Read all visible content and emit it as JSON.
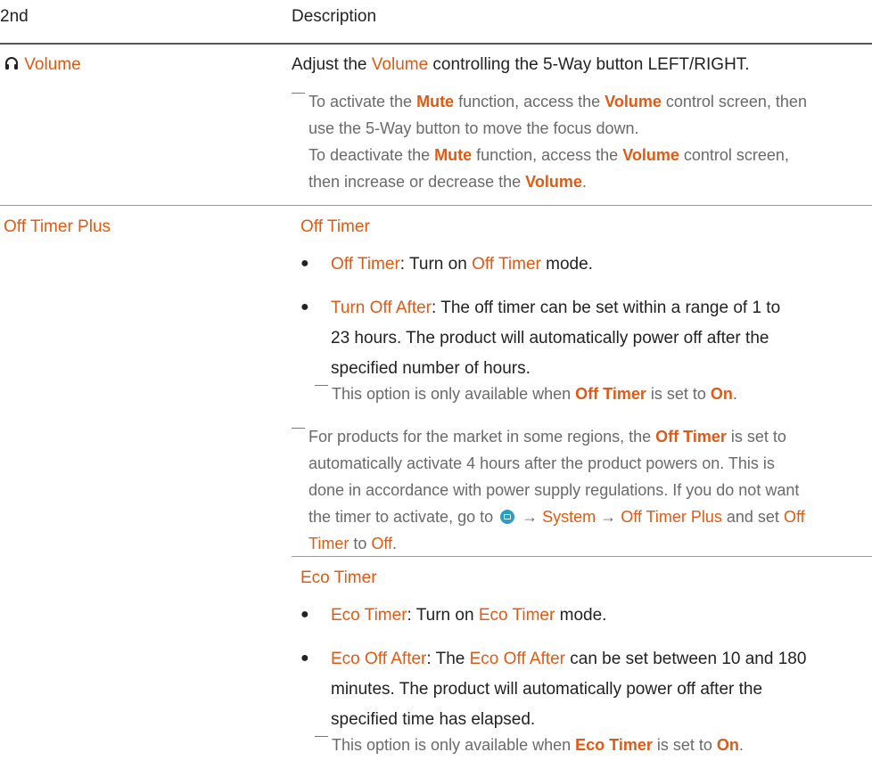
{
  "header": {
    "col1": "2nd",
    "col2": "Description"
  },
  "volume": {
    "label": "Volume",
    "desc_pre": "Adjust the ",
    "desc_hl": "Volume",
    "desc_post": " controlling the 5-Way button LEFT/RIGHT.",
    "note1": [
      "To activate the ",
      "Mute",
      " function, access the ",
      "Volume",
      " control screen, then"
    ],
    "note2": "use the 5-Way button to move the focus down.",
    "note3": [
      "To deactivate the ",
      "Mute",
      " function, access the ",
      "Volume",
      " control screen,"
    ],
    "note4": [
      "then increase or decrease the ",
      "Volume",
      "."
    ]
  },
  "off_timer_plus": {
    "label": "Off Timer Plus",
    "section": "Off Timer",
    "b1": [
      "Off Timer",
      ": Turn on ",
      "Off Timer",
      " mode."
    ],
    "b2_l1": [
      "Turn Off After",
      ": The off timer can be set within a range of 1 to"
    ],
    "b2_l2": "23 hours. The product will automatically power off after the",
    "b2_l3": "specified number of hours.",
    "note_a": [
      "This option is only available when ",
      "Off Timer",
      " is set to ",
      "On",
      "."
    ],
    "note_b1": [
      "For products for the market in some regions, the ",
      "Off Timer",
      " is set to"
    ],
    "note_b2": "automatically activate 4 hours after the product powers on. This is",
    "note_b3": "done in accordance with power supply regulations. If you do not want",
    "note_b4": [
      "the timer to activate, go to ",
      "→",
      "System",
      "→",
      "Off Timer Plus",
      " and set ",
      "Off"
    ],
    "note_b5": [
      "Timer",
      " to ",
      "Off",
      "."
    ]
  },
  "eco_timer": {
    "section": "Eco Timer",
    "b1": [
      "Eco Timer",
      ": Turn on ",
      "Eco Timer",
      " mode."
    ],
    "b2_l1": [
      "Eco Off After",
      ": The ",
      "Eco Off After",
      " can be set between 10 and 180"
    ],
    "b2_l2": "minutes. The product will automatically power off after the",
    "b2_l3": "specified time has elapsed.",
    "note": [
      "This option is only available when ",
      "Eco Timer",
      " is set to ",
      "On",
      "."
    ]
  },
  "icons": {
    "volume": "headphones-icon",
    "menu": "menu-icon"
  },
  "colors": {
    "accent": "#e05a14",
    "note": "#6a6a6a",
    "icon": "#2a9ec0"
  }
}
